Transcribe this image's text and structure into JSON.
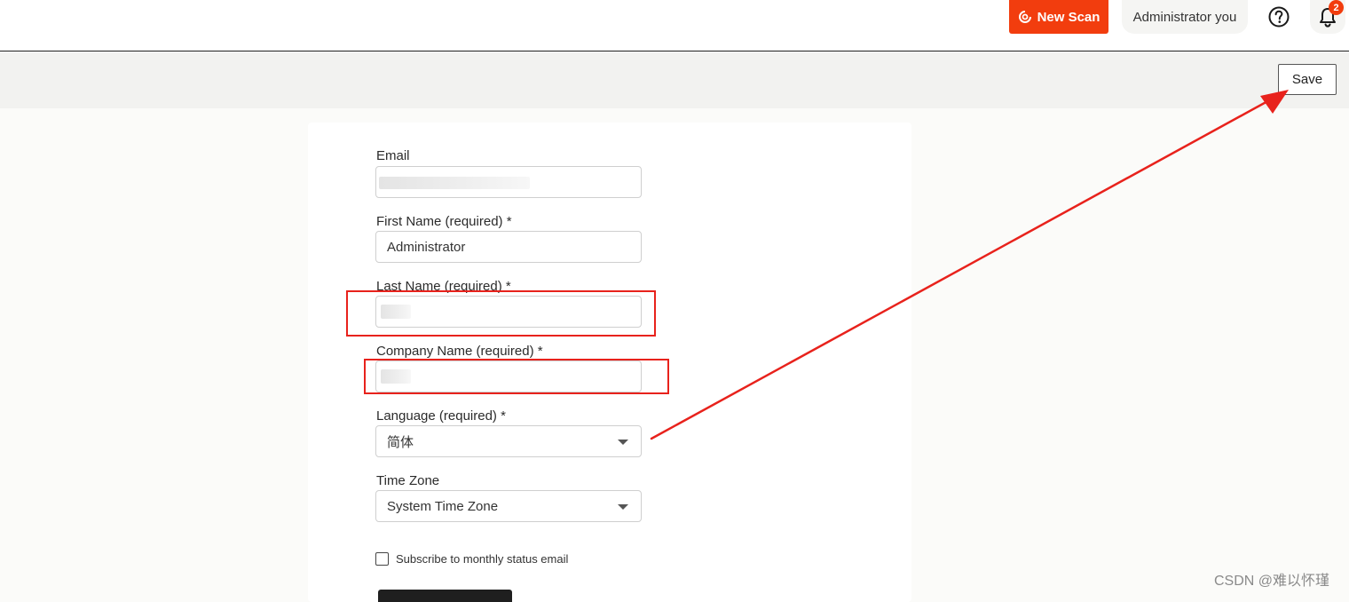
{
  "header": {
    "new_scan_label": "New Scan",
    "user_label": "Administrator you",
    "notification_count": "2",
    "brand_color": "#f23d0e"
  },
  "toolbar": {
    "save_label": "Save"
  },
  "form": {
    "email": {
      "label": "Email",
      "value": ""
    },
    "first_name": {
      "label": "First Name (required) *",
      "value": "Administrator"
    },
    "last_name": {
      "label": "Last Name (required) *",
      "value": ""
    },
    "company_name": {
      "label": "Company Name (required) *",
      "value": ""
    },
    "language": {
      "label": "Language (required) *",
      "selected": "简体"
    },
    "time_zone": {
      "label": "Time Zone",
      "selected": "System Time Zone"
    },
    "subscribe": {
      "label": "Subscribe to monthly status email",
      "checked": false
    }
  },
  "annotations": {
    "highlight_color": "#e8221c"
  },
  "watermark": "CSDN @难以怀瑾"
}
